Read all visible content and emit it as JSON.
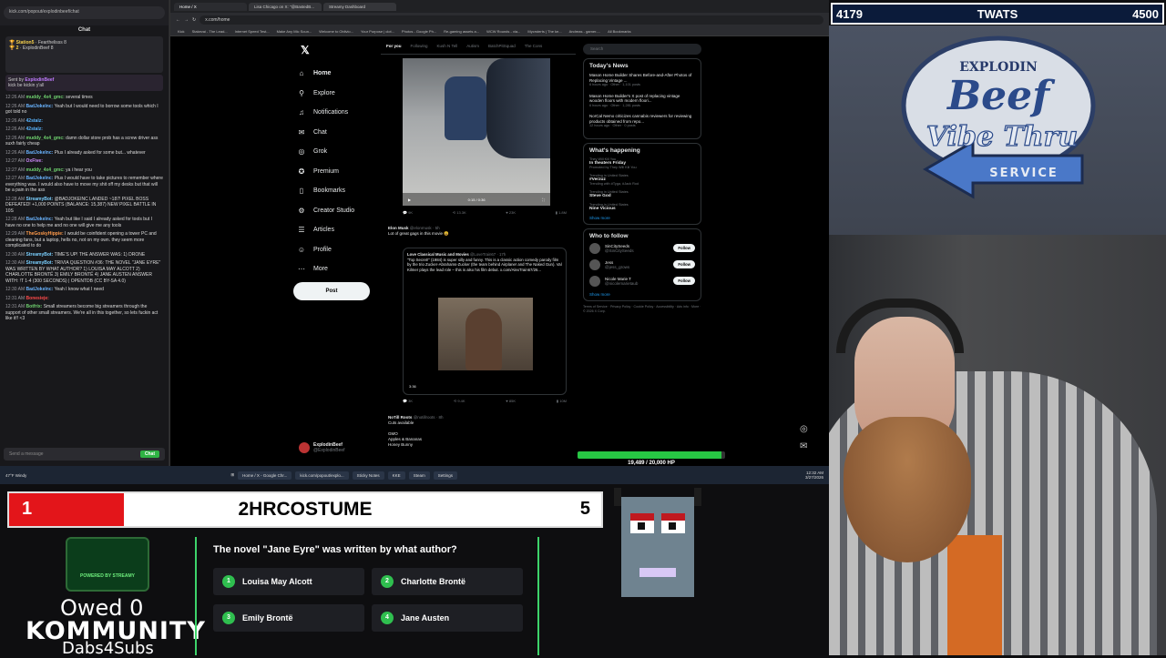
{
  "chat": {
    "url": "kick.com/popout/explodinbeef/chat",
    "title": "Chat",
    "pinned": [
      {
        "rank": "Station5",
        "value": "Fearthelisss",
        "count": "8"
      },
      {
        "rank": "2",
        "value": "ExplodinBeef",
        "count": "8"
      }
    ],
    "sentby_label": "Sent by",
    "sentby_user": "ExplodinBeef",
    "sentby_text": "kick be kickin y'all",
    "messages": [
      {
        "t": "12:26 AM",
        "u": "muddy_4x4_gmc:",
        "c": "#6fd26f",
        "m": "several times"
      },
      {
        "t": "12:26 AM",
        "u": "BadJokeInc:",
        "c": "#6ab4ff",
        "m": "Yeah but I would need to borrow some tools which I got told no"
      },
      {
        "t": "12:26 AM",
        "u": "42stalz:",
        "c": "#59b5ff",
        "m": ""
      },
      {
        "t": "12:26 AM",
        "u": "42stalz:",
        "c": "#59b5ff",
        "m": ""
      },
      {
        "t": "12:26 AM",
        "u": "muddy_4x4_gmc:",
        "c": "#6fd26f",
        "m": "damn dollar store prob has a screw driver ass suxh fairly cheap"
      },
      {
        "t": "12:26 AM",
        "u": "BadJokeInc:",
        "c": "#6ab4ff",
        "m": "Plus I already asked for some but... whatever"
      },
      {
        "t": "12:27 AM",
        "u": "OxFive:",
        "c": "#d28cff",
        "m": ""
      },
      {
        "t": "12:27 AM",
        "u": "muddy_4x4_gmc:",
        "c": "#6fd26f",
        "m": "ya i hear you"
      },
      {
        "t": "12:27 AM",
        "u": "BadJokeInc:",
        "c": "#6ab4ff",
        "m": "Plus I would have to take pictures to remember where everything was. I would also have to move my shit off my desks but that will be a pain in the ass"
      },
      {
        "t": "12:28 AM",
        "u": "StreamyBot:",
        "c": "#7ad0ff",
        "m": "@BADJOKEINC LANDED ~187! PIXEL BOSS DEFEATED! +1,000 POINTS (BALANCE: 15,387) NEW PIXEL BATTLE IN 10S"
      },
      {
        "t": "12:28 AM",
        "u": "BadJokeInc:",
        "c": "#6ab4ff",
        "m": "Yeah but like I said I already asked for tools but I have no one to help me and no one will give me any tools"
      },
      {
        "t": "12:29 AM",
        "u": "TheGoskyHippie:",
        "c": "#ff9a4a",
        "m": "I would be coinfident opening a tower PC and cleaning fans, but a laptop, hells no, not on my own. they seem more complicated to do"
      },
      {
        "t": "12:30 AM",
        "u": "StreamyBot:",
        "c": "#7ad0ff",
        "m": "TIME'S UP! THE ANSWER WAS: 1) DRONE"
      },
      {
        "t": "12:30 AM",
        "u": "StreamyBot:",
        "c": "#7ad0ff",
        "m": "TRIVIA QUESTION #36: THE NOVEL \"JANE EYRE\" WAS WRITTEN BY WHAT AUTHOR? 1) LOUISA MAY ALCOTT 2) CHARLOTTE BRONTË 3) EMILY BRONTË 4) JANE AUSTEN ANSWER WITH: !T 1-4 (300 SECONDS) | OPENTDB (CC BY-SA 4.0)"
      },
      {
        "t": "12:30 AM",
        "u": "BadJokeInc:",
        "c": "#6ab4ff",
        "m": "Yeah I know what I need"
      },
      {
        "t": "12:31 AM",
        "u": "Bonesieje:",
        "c": "#ff4a4a",
        "m": ""
      },
      {
        "t": "12:31 AM",
        "u": "Botfrix:",
        "c": "#6fd26f",
        "m": "Small streamers become big streamers through the support of other small streamers. We're all in this together, so lets fuckin act like it!! <3"
      }
    ],
    "input_placeholder": "Send a message",
    "send_label": "Chat"
  },
  "browser": {
    "tabs": [
      "Home / X",
      "Lisa Chicago on X: \"@BastedB...",
      "Streamy Dashboard"
    ],
    "url": "x.com/home",
    "bookmarks": [
      "Kick",
      "Stakevai - The Lead...",
      "Internet Speed Test...",
      "Make Any Mic Soun...",
      "Welcome to Oblivio...",
      "Your Purpose | clot...",
      "Photos - Google Ph...",
      "Re-gaming assets a...",
      "WCW Rounds - via...",
      "Mycrsterts | The ke...",
      "Andreas - gamer-...",
      "All Bookmarks"
    ]
  },
  "x": {
    "nav": [
      {
        "label": "Home",
        "icon": "house-icon",
        "glyph": "⌂"
      },
      {
        "label": "Explore",
        "icon": "search-icon",
        "glyph": "⚲"
      },
      {
        "label": "Notifications",
        "icon": "bell-icon",
        "glyph": "♫"
      },
      {
        "label": "Chat",
        "icon": "chat-icon",
        "glyph": "✉"
      },
      {
        "label": "Grok",
        "icon": "grok-icon",
        "glyph": "◎"
      },
      {
        "label": "Premium",
        "icon": "premium-icon",
        "glyph": "✪"
      },
      {
        "label": "Bookmarks",
        "icon": "bookmark-icon",
        "glyph": "▯"
      },
      {
        "label": "Creator Studio",
        "icon": "creator-icon",
        "glyph": "⚙"
      },
      {
        "label": "Articles",
        "icon": "articles-icon",
        "glyph": "☰"
      },
      {
        "label": "Profile",
        "icon": "profile-icon",
        "glyph": "☺"
      },
      {
        "label": "More",
        "icon": "more-icon",
        "glyph": "⋯"
      }
    ],
    "post_label": "Post",
    "profile_name": "ExplodinBeef",
    "profile_handle": "@ExplodinBeef",
    "feed_tabs": [
      "For you",
      "Following",
      "Kush N Tell",
      "Autism",
      "BatchPitSquad",
      "The Cons"
    ],
    "video_time": "0:15 / 0:36",
    "post1_stats": [
      "9K",
      "13.3K",
      "23K",
      "1.8M"
    ],
    "tweet2": {
      "name": "Elon Musk",
      "handle": "@elonmusk · 5h",
      "text": "Lot of great gags in this movie 😆"
    },
    "quote": {
      "name": "Love Classical Music and Movies",
      "handle": "@LoveTrain67 · 17h",
      "text": "\"Top Secret!\" (1984) is super silly and funny. This is a classic action comedy parody film by the trio Zucker-Abrahams-Zucker (the team behind Airplane! and The Naked Gun). Val Kilmer plays the lead role – this is also his film debut. x.com/AlexTrain67/26...",
      "duration": "3:36"
    },
    "post2_stats": [
      "3K",
      "9.4K",
      "85K",
      "10M"
    ],
    "tweet3": {
      "name": "NoTill Roots",
      "handle": "@notillroots · 8h",
      "lines": [
        "Cuts available",
        "",
        "GMO",
        "Apples & Bananas",
        "Honey Bunny"
      ]
    },
    "search_placeholder": "Search",
    "todays_news_title": "Today's News",
    "news": [
      {
        "title": "Mason Home Builder Shares Before-and-After Photos of Replacing Vintage ...",
        "meta": "6 hours ago · Other · 1,101 posts"
      },
      {
        "title": "Mason Home Builder's X post of replacing vintage wooden floors with modern floori...",
        "meta": "6 hours ago · Other · 1,281 posts"
      },
      {
        "title": "NorCal Nemo criticizes cannabis reviewers for reviewing products obtained from repo...",
        "meta": "12 hours ago · Other · 0 posts"
      }
    ],
    "happening_title": "What's happening",
    "trends": [
      {
        "cat": "They Will Kill You",
        "title": "In theaters Friday",
        "meta": "Promoted by They Will Kill You"
      },
      {
        "cat": "Trending in United States",
        "title": "#Verzuz",
        "meta": "Trending with #Tyga, #Jack Rod"
      },
      {
        "cat": "Trending in United States",
        "title": "Steve God",
        "meta": ""
      },
      {
        "cat": "Trending in United States",
        "title": "Nine Vicious",
        "meta": ""
      }
    ],
    "show_more": "Show more",
    "who_title": "Who to follow",
    "who": [
      {
        "name": "SinCitySeeds",
        "handle": "@SinCitySeeds",
        "btn": "Follow"
      },
      {
        "name": "Jess",
        "handle": "@jess_grows",
        "btn": "Follow"
      },
      {
        "name": "Nicole Marie T",
        "handle": "@nicolemarietaub",
        "btn": "Follow"
      }
    ],
    "footer": "Terms of Service · Privacy Policy · Cookie Policy · Accessibility · Ads info · More · © 2026 X Corp."
  },
  "hp": {
    "text": "19,489 / 20,000 HP",
    "fraction": 0.974,
    "color": "#27c744"
  },
  "taskbar": {
    "weather": "47°F Windy",
    "apps": [
      "Home / X - Google Chr...",
      "kick.com/popout/explo...",
      "Sticky Notes",
      "KKE",
      "Steam",
      "Settings"
    ],
    "time": "12:32 AM",
    "date": "3/27/2026"
  },
  "overlay_top": {
    "left": "4179",
    "title": "TWATS",
    "right": "4500"
  },
  "sign": {
    "top": "EXPLODIN",
    "beef": "Beef",
    "vibe": "Vibe Thru",
    "service": "SERVICE"
  },
  "score": {
    "left": "1",
    "name": "2HRCOSTUME",
    "right": "5"
  },
  "streamy": {
    "badge": "POWERED BY STREAMY"
  },
  "owed": "Owed 0",
  "kommunity": "KOMMUNITY",
  "dabs": "Dabs4Subs",
  "trivia": {
    "question": "The novel \"Jane Eyre\" was written by what author?",
    "answers": [
      {
        "n": "1",
        "label": "Louisa May Alcott"
      },
      {
        "n": "2",
        "label": "Charlotte Brontë"
      },
      {
        "n": "3",
        "label": "Emily Brontë"
      },
      {
        "n": "4",
        "label": "Jane Austen"
      }
    ]
  }
}
